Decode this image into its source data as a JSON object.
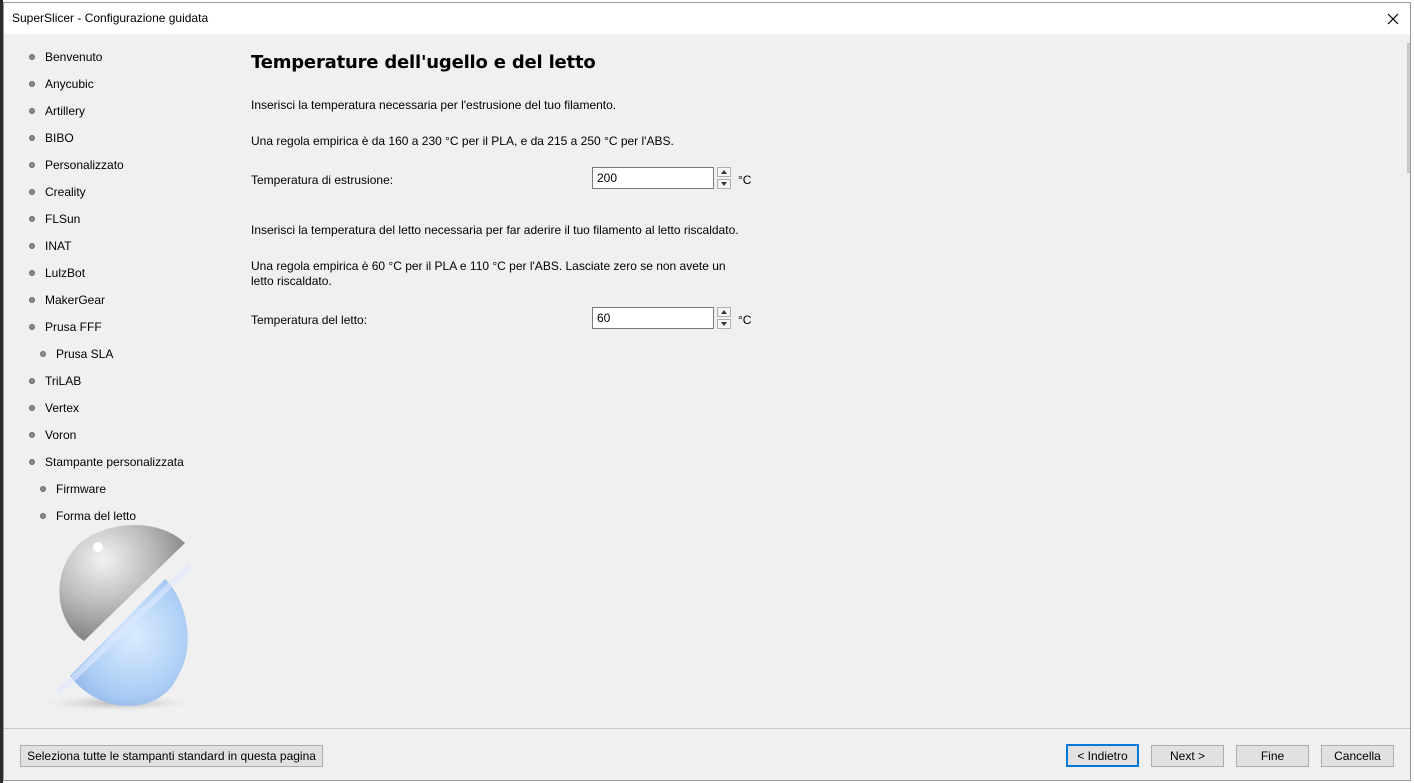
{
  "window": {
    "title": "SuperSlicer - Configurazione guidata"
  },
  "sidebar": {
    "items": [
      {
        "label": "Benvenuto"
      },
      {
        "label": "Anycubic"
      },
      {
        "label": "Artillery"
      },
      {
        "label": "BIBO"
      },
      {
        "label": "Personalizzato"
      },
      {
        "label": "Creality"
      },
      {
        "label": "FLSun"
      },
      {
        "label": "INAT"
      },
      {
        "label": "LulzBot"
      },
      {
        "label": "MakerGear"
      },
      {
        "label": "Prusa FFF"
      },
      {
        "label": "Prusa SLA"
      },
      {
        "label": "TriLAB"
      },
      {
        "label": "Vertex"
      },
      {
        "label": "Voron"
      },
      {
        "label": "Stampante personalizzata"
      },
      {
        "label": "Firmware"
      },
      {
        "label": "Forma del letto"
      }
    ]
  },
  "main": {
    "heading": "Temperature dell'ugello e del letto",
    "extrusion_intro": "Inserisci la temperatura necessaria per l'estrusione del tuo filamento.",
    "extrusion_rule": "Una regola empirica è da 160 a 230 °C per il PLA, e da 215 a 250 °C per l'ABS.",
    "extrusion_label": "Temperatura di estrusione:",
    "extrusion_value": "200",
    "bed_intro": "Inserisci la temperatura del letto necessaria per far aderire il tuo filamento al letto riscaldato.",
    "bed_rule": "Una regola empirica è 60 °C per il PLA e 110 °C per l'ABS. Lasciate zero se non avete un letto riscaldato.",
    "bed_label": "Temperatura del letto:",
    "bed_value": "60",
    "unit": "°C"
  },
  "footer": {
    "select_all_label": "Seleziona tutte le stampanti standard in questa pagina",
    "back_label": "< Indietro",
    "next_label": "Next >",
    "finish_label": "Fine",
    "cancel_label": "Cancella"
  },
  "colors": {
    "accent": "#0078d7",
    "window_bg": "#f0f0f0",
    "button_bg": "#e1e1e1"
  }
}
